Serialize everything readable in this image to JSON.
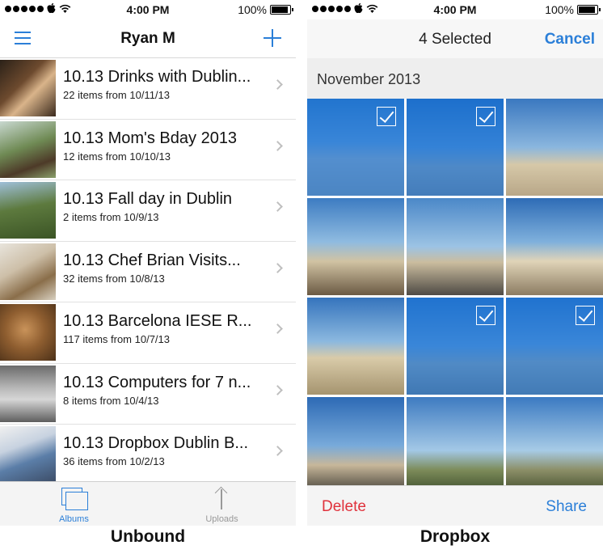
{
  "left_app": {
    "status": {
      "time": "4:00 PM",
      "battery": "100%",
      "battery_level": 1.0
    },
    "nav": {
      "title": "Ryan M",
      "menu_icon": "hamburger-icon",
      "add_icon": "plus-icon"
    },
    "albums": [
      {
        "title": "10.13 Drinks with Dublin...",
        "subtitle": "22 items from 10/11/13"
      },
      {
        "title": "10.13 Mom's Bday 2013",
        "subtitle": "12 items from 10/10/13"
      },
      {
        "title": "10.13 Fall day in Dublin",
        "subtitle": "2 items from 10/9/13"
      },
      {
        "title": "10.13 Chef Brian Visits...",
        "subtitle": "32 items from 10/8/13"
      },
      {
        "title": "10.13 Barcelona IESE R...",
        "subtitle": "117 items from 10/7/13"
      },
      {
        "title": "10.13 Computers for 7 n...",
        "subtitle": "8 items from 10/4/13"
      },
      {
        "title": "10.13 Dropbox Dublin B...",
        "subtitle": "36 items from 10/2/13"
      }
    ],
    "tabs": {
      "albums": "Albums",
      "uploads": "Uploads"
    },
    "caption": "Unbound"
  },
  "right_app": {
    "status": {
      "time": "4:00 PM",
      "battery": "100%",
      "battery_level": 1.0
    },
    "nav": {
      "title": "4 Selected",
      "cancel": "Cancel"
    },
    "section": "November 2013",
    "photos": [
      {
        "selected": true
      },
      {
        "selected": true
      },
      {
        "selected": false
      },
      {
        "selected": false
      },
      {
        "selected": false
      },
      {
        "selected": false
      },
      {
        "selected": false
      },
      {
        "selected": true
      },
      {
        "selected": true
      },
      {
        "selected": false
      },
      {
        "selected": false
      },
      {
        "selected": false
      }
    ],
    "actions": {
      "delete": "Delete",
      "share": "Share"
    },
    "caption": "Dropbox"
  },
  "colors": {
    "accent": "#2b7fd8",
    "delete": "#e0323c",
    "selection": "#1570d6"
  }
}
